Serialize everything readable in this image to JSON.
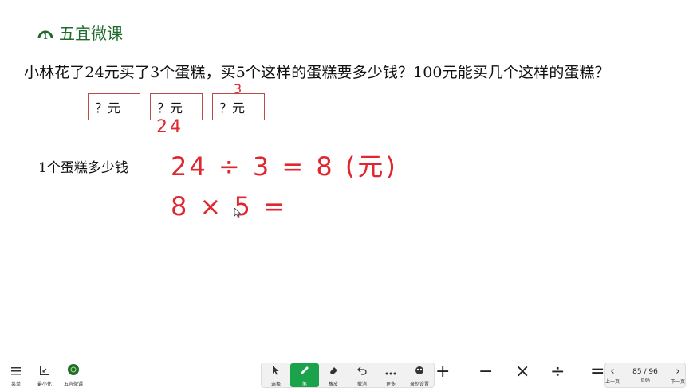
{
  "brand": {
    "logo_digit": "1",
    "title": "五宜微课"
  },
  "problem": {
    "question": "小林花了24元买了3个蛋糕，买5个这样的蛋糕要多少钱？100元能买几个这样的蛋糕？",
    "boxes": [
      "？元",
      "？元",
      "？元"
    ],
    "step_label": "1个蛋糕多少钱"
  },
  "handwriting": {
    "above_box3": "3",
    "below_box2": "24",
    "line1": "24 ÷ 3 = 8 (元)",
    "line2": "8 × 5 ="
  },
  "toolbar": {
    "left": [
      {
        "label": "菜单",
        "icon": "menu-icon"
      },
      {
        "label": "最小化",
        "icon": "minimize-icon"
      },
      {
        "label": "五宜微课",
        "icon": "app-logo-icon"
      }
    ],
    "center": [
      {
        "label": "选择",
        "icon": "cursor-icon"
      },
      {
        "label": "笔",
        "icon": "pen-icon"
      },
      {
        "label": "橡皮",
        "icon": "eraser-icon"
      },
      {
        "label": "撤消",
        "icon": "undo-icon"
      },
      {
        "label": "更多",
        "icon": "more-icon"
      },
      {
        "label": "录制设置",
        "icon": "record-settings-icon"
      }
    ],
    "operators": [
      "+",
      "−",
      "×",
      "÷",
      "="
    ],
    "pager": {
      "prev": "上一页",
      "page_indicator": "85 / 96",
      "page_label": "页码",
      "next": "下一页"
    }
  },
  "colors": {
    "accent_green": "#1aa34a",
    "ink_red": "#e0262f",
    "box_border": "#b94a48"
  }
}
